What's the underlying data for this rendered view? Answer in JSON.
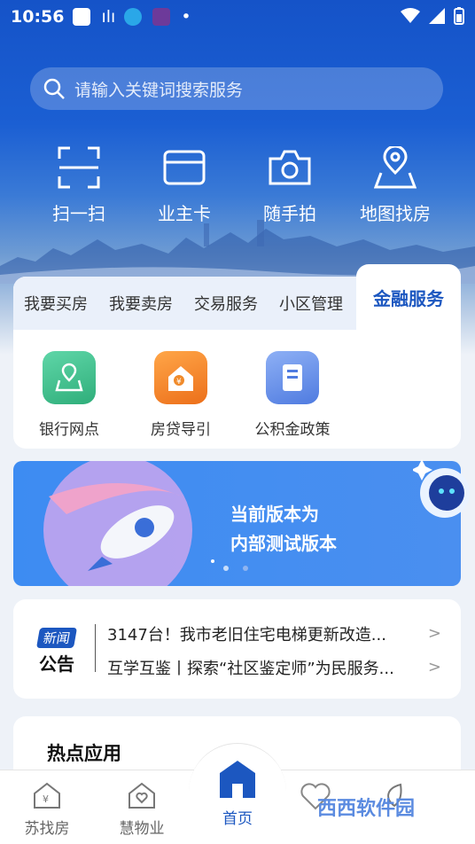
{
  "status_bar": {
    "time": "10:56"
  },
  "search": {
    "placeholder": "请输入关键词搜索服务"
  },
  "quick_actions": [
    "扫一扫",
    "业主卡",
    "随手拍",
    "地图找房"
  ],
  "tabs": [
    "我要买房",
    "我要卖房",
    "交易服务",
    "小区管理",
    "金融服务"
  ],
  "active_tab": "金融服务",
  "services": [
    {
      "label": "银行网点",
      "icon": "map-pin-icon",
      "color": "#3dbf8a"
    },
    {
      "label": "房贷导引",
      "icon": "house-loan-icon",
      "color": "#f38b2a"
    },
    {
      "label": "公积金政策",
      "icon": "document-book-icon",
      "color": "#5a86e6"
    }
  ],
  "banner": {
    "line1": "当前版本为",
    "line2": "内部测试版本"
  },
  "news": {
    "badge_top": "新闻",
    "badge_bottom": "公告",
    "items": [
      "3147台！我市老旧住宅电梯更新改造...",
      "互学互鉴丨探索“社区鉴定师”为民服务..."
    ]
  },
  "hot_apps": {
    "title": "热点应用"
  },
  "nav": [
    "苏找房",
    "慧物业",
    "首页",
    "",
    ""
  ],
  "nav_active": "首页",
  "watermark": "西西软件园"
}
